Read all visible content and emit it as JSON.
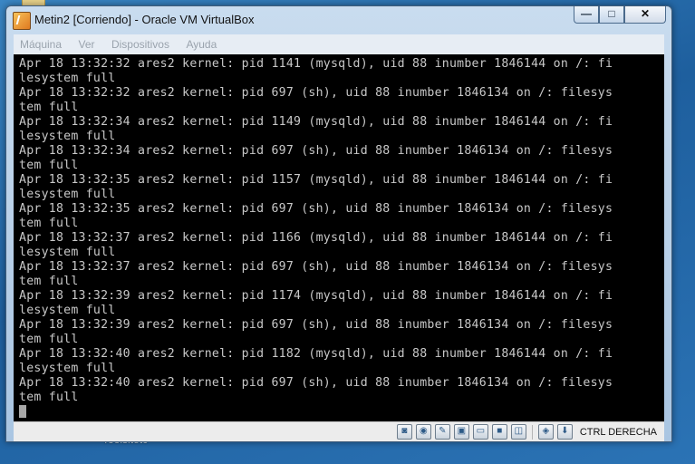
{
  "desktop": {
    "icon_label": "Toolsitetc"
  },
  "window": {
    "title": "Metin2 [Corriendo] - Oracle VM VirtualBox",
    "controls": {
      "minimize": "—",
      "maximize": "□",
      "close": "✕"
    }
  },
  "menubar": {
    "items": [
      "Máquina",
      "Ver",
      "Dispositivos",
      "Ayuda"
    ]
  },
  "console": {
    "lines": [
      "Apr 18 13:32:32 ares2 kernel: pid 1141 (mysqld), uid 88 inumber 1846144 on /: fi",
      "lesystem full",
      "Apr 18 13:32:32 ares2 kernel: pid 697 (sh), uid 88 inumber 1846134 on /: filesys",
      "tem full",
      "Apr 18 13:32:34 ares2 kernel: pid 1149 (mysqld), uid 88 inumber 1846144 on /: fi",
      "lesystem full",
      "Apr 18 13:32:34 ares2 kernel: pid 697 (sh), uid 88 inumber 1846134 on /: filesys",
      "tem full",
      "Apr 18 13:32:35 ares2 kernel: pid 1157 (mysqld), uid 88 inumber 1846144 on /: fi",
      "lesystem full",
      "Apr 18 13:32:35 ares2 kernel: pid 697 (sh), uid 88 inumber 1846134 on /: filesys",
      "tem full",
      "Apr 18 13:32:37 ares2 kernel: pid 1166 (mysqld), uid 88 inumber 1846144 on /: fi",
      "lesystem full",
      "Apr 18 13:32:37 ares2 kernel: pid 697 (sh), uid 88 inumber 1846134 on /: filesys",
      "tem full",
      "Apr 18 13:32:39 ares2 kernel: pid 1174 (mysqld), uid 88 inumber 1846144 on /: fi",
      "lesystem full",
      "Apr 18 13:32:39 ares2 kernel: pid 697 (sh), uid 88 inumber 1846134 on /: filesys",
      "tem full",
      "Apr 18 13:32:40 ares2 kernel: pid 1182 (mysqld), uid 88 inumber 1846144 on /: fi",
      "lesystem full",
      "Apr 18 13:32:40 ares2 kernel: pid 697 (sh), uid 88 inumber 1846134 on /: filesys",
      "tem full"
    ]
  },
  "statusbar": {
    "icons": [
      "hard-disk-icon",
      "optical-drive-icon",
      "usb-icon",
      "network-icon",
      "shared-folders-icon",
      "display-icon",
      "video-capture-icon",
      "mouse-integration-icon",
      "host-key-arrow-icon"
    ],
    "host_key": "CTRL DERECHA"
  },
  "colors": {
    "console_bg": "#000000",
    "console_fg": "#c8c8c8",
    "window_frame": "#a9c5e2",
    "desktop": "#1e5f9e"
  }
}
